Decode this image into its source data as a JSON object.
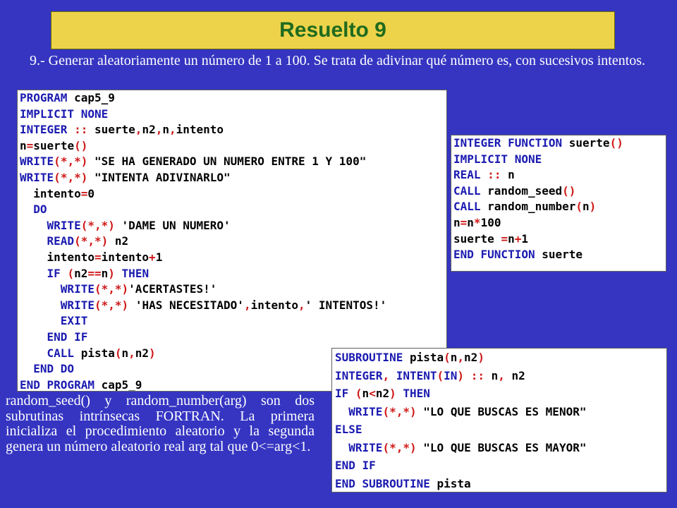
{
  "title": "Resuelto 9",
  "statement": "9.- Generar aleatoriamente un número de 1 a 100. Se trata de adivinar qué número es, con sucesivos intentos.",
  "main_program": {
    "lines": [
      "PROGRAM cap5_9",
      "IMPLICIT NONE",
      "INTEGER :: suerte,n2,n,intento",
      "n=suerte()",
      "WRITE(*,*) \"SE HA GENERADO UN NUMERO ENTRE 1 Y 100\"",
      "WRITE(*,*) \"INTENTA ADIVINARLO\"",
      "  intento=0",
      "  DO",
      "    WRITE(*,*) 'DAME UN NUMERO'",
      "    READ(*,*) n2",
      "    intento=intento+1",
      "    IF (n2==n) THEN",
      "      WRITE(*,*)'ACERTASTES!'",
      "      WRITE(*,*) 'HAS NECESITADO',intento,' INTENTOS!'",
      "      EXIT",
      "    END IF",
      "    CALL pista(n,n2)",
      "  END DO",
      "END PROGRAM cap5_9"
    ]
  },
  "function_suerte": {
    "lines": [
      "INTEGER FUNCTION suerte()",
      "IMPLICIT NONE",
      "REAL :: n",
      "CALL random_seed()",
      "CALL random_number(n)",
      "n=n*100",
      "suerte =n+1",
      "END FUNCTION suerte"
    ]
  },
  "subroutine_pista": {
    "lines": [
      "SUBROUTINE pista(n,n2)",
      "INTEGER, INTENT(IN) :: n, n2",
      "IF (n<n2) THEN",
      "  WRITE(*,*) \"LO QUE BUSCAS ES MENOR\"",
      "ELSE",
      "  WRITE(*,*) \"LO QUE BUSCAS ES MAYOR\"",
      "END IF",
      "END SUBROUTINE pista"
    ]
  },
  "note": "random_seed() y random_number(arg) son dos subrutinas intrínsecas FORTRAN. La primera inicializa el procedimiento aleatorio y la segunda genera un número aleatorio real arg tal que 0<=arg<1.",
  "colors": {
    "background": "#3535c2",
    "title_bar": "#ecd34a",
    "title_text": "#1f6b1f",
    "keyword": "#1a1ab0",
    "operator": "#d01818"
  }
}
